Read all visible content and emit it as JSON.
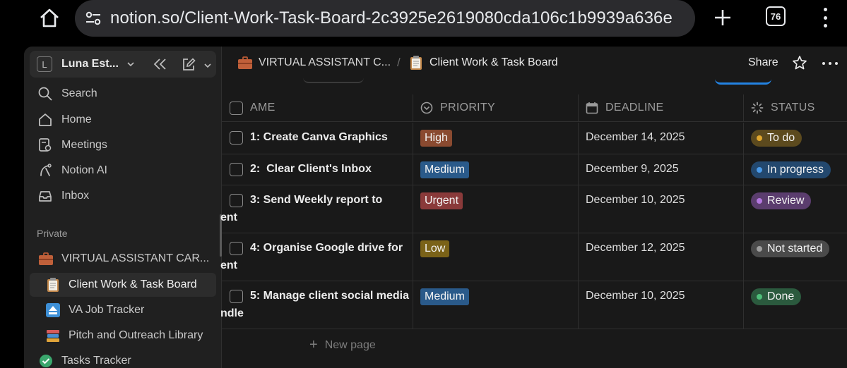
{
  "browser": {
    "url": "notion.so/Client-Work-Task-Board-2c3925e2619080cda106c1b9939a636e",
    "tab_count": "76"
  },
  "sidebar": {
    "workspace_initial": "L",
    "workspace_name": "Luna Est...",
    "nav": [
      {
        "label": "Search",
        "icon": "search-icon"
      },
      {
        "label": "Home",
        "icon": "home-icon"
      },
      {
        "label": "Meetings",
        "icon": "meetings-icon"
      },
      {
        "label": "Notion AI",
        "icon": "notion-ai-icon"
      },
      {
        "label": "Inbox",
        "icon": "inbox-icon"
      }
    ],
    "section_private": "Private",
    "pages": [
      {
        "label": "VIRTUAL ASSISTANT CAR...",
        "icon": "briefcase-icon"
      },
      {
        "label": "Client Work & Task Board",
        "icon": "clipboard-icon"
      },
      {
        "label": "VA Job Tracker",
        "icon": "eject-icon"
      },
      {
        "label": "Pitch and Outreach Library",
        "icon": "books-icon"
      },
      {
        "label": "Tasks Tracker",
        "icon": "check-circle-icon"
      }
    ]
  },
  "header": {
    "breadcrumb_parent": "VIRTUAL ASSISTANT C...",
    "breadcrumb_sep": "/",
    "breadcrumb_current": "Client Work & Task Board",
    "share_label": "Share"
  },
  "table": {
    "columns": {
      "name": "AME",
      "priority": "PRIORITY",
      "deadline": "DEADLINE",
      "status": "STATUS"
    },
    "rows": [
      {
        "name": "1: Create Canva Graphics",
        "wrap": "",
        "priority": "High",
        "priority_color": "#8a4a30",
        "deadline": "December 14, 2025",
        "status": "To do",
        "status_bg": "#5c4a1e",
        "status_dot": "#e0a72e"
      },
      {
        "name": "2:  Clear Client's Inbox",
        "wrap": "",
        "priority": "Medium",
        "priority_color": "#2a5a8a",
        "deadline": "December 9, 2025",
        "status": "In progress",
        "status_bg": "#23486e",
        "status_dot": "#4a9ae8"
      },
      {
        "name": "3: Send Weekly report to",
        "wrap": "ent",
        "priority": "Urgent",
        "priority_color": "#8a3a3a",
        "deadline": "December 10, 2025",
        "status": "Review",
        "status_bg": "#5b3d6e",
        "status_dot": "#b478e0"
      },
      {
        "name": "4: Organise Google drive for",
        "wrap": "ent",
        "priority": "Low",
        "priority_color": "#7a6218",
        "deadline": "December 12, 2025",
        "status": "Not started",
        "status_bg": "#4a4a4a",
        "status_dot": "#9e9e9e"
      },
      {
        "name": "5: Manage client social media",
        "wrap": "ndle",
        "priority": "Medium",
        "priority_color": "#2a5a8a",
        "deadline": "December 10, 2025",
        "status": "Done",
        "status_bg": "#2b5a3e",
        "status_dot": "#4fbf7a"
      }
    ],
    "new_page_label": "New page"
  }
}
